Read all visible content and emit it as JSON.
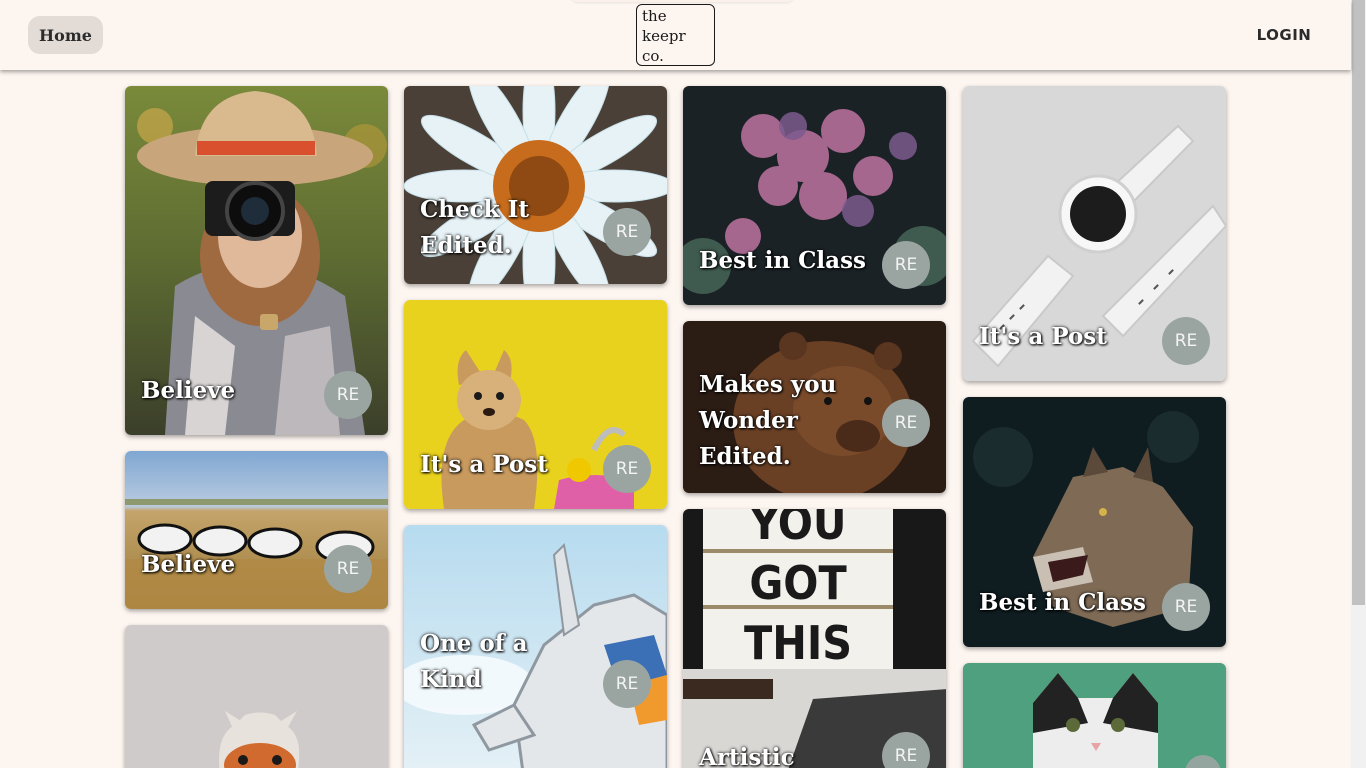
{
  "nav": {
    "home_label": "Home",
    "logo_text": "the\nkeepr\nco.",
    "login_label": "LOGIN"
  },
  "cards": [
    {
      "title": "Believe",
      "avatar": "RE"
    },
    {
      "title": "Believe",
      "avatar": "RE"
    },
    {
      "title": "",
      "avatar": ""
    },
    {
      "title": "Check It Edited.",
      "avatar": "RE"
    },
    {
      "title": "It's a Post",
      "avatar": "RE"
    },
    {
      "title": "One of a Kind",
      "avatar": "RE"
    },
    {
      "title": "Best in Class",
      "avatar": "RE"
    },
    {
      "title": "Makes you Wonder Edited.",
      "avatar": "RE"
    },
    {
      "title": "Artistic",
      "avatar": "RE"
    },
    {
      "title": "It's a Post",
      "avatar": "RE"
    },
    {
      "title": "Best in Class",
      "avatar": "RE"
    },
    {
      "title": "",
      "avatar": ""
    }
  ],
  "lightbox_text": "YOU\nGOT\nTHIS"
}
